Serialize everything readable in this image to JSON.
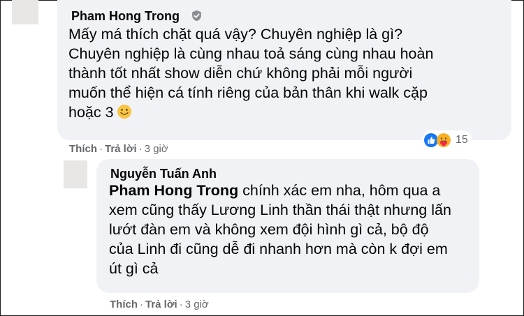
{
  "comment": {
    "author": "Pham Hong Trong",
    "lines": [
      "Mấy má thích chặt quá vậy? Chuyên nghiệp là gì?",
      "Chuyên nghiệp là cùng nhau toả sáng cùng nhau hoàn",
      "thành tốt nhất show diễn chứ không phải mỗi người",
      "muốn thể hiện cá tính riêng của bản thân khi walk cặp",
      "hoặc 3"
    ],
    "emoji": "smile-emoji",
    "reactions": {
      "icons": [
        "like-icon",
        "care-icon"
      ],
      "count": "15"
    },
    "actions": {
      "like": "Thích",
      "reply": "Trả lời",
      "sep": "·",
      "time": "3 giờ"
    }
  },
  "reply": {
    "author": "Nguyễn Tuấn Anh",
    "mention": "Pham Hong Trong",
    "lines": [
      " chính xác em nha, hôm qua a",
      "xem cũng thấy Lương Linh thần thái thật nhưng lấn",
      "lướt đàn em và không xem đội hình gì cả, bộ độ",
      "của Linh đi cũng dễ đi nhanh hơn mà còn k đợi em",
      "út gì cả"
    ],
    "actions": {
      "like": "Thích",
      "reply": "Trả lời",
      "sep": "·",
      "time": "3 giờ"
    }
  },
  "colors": {
    "bubble": "#f0f2f5",
    "meta": "#65676b",
    "like": "#1877f2",
    "care": "#f7b125"
  }
}
